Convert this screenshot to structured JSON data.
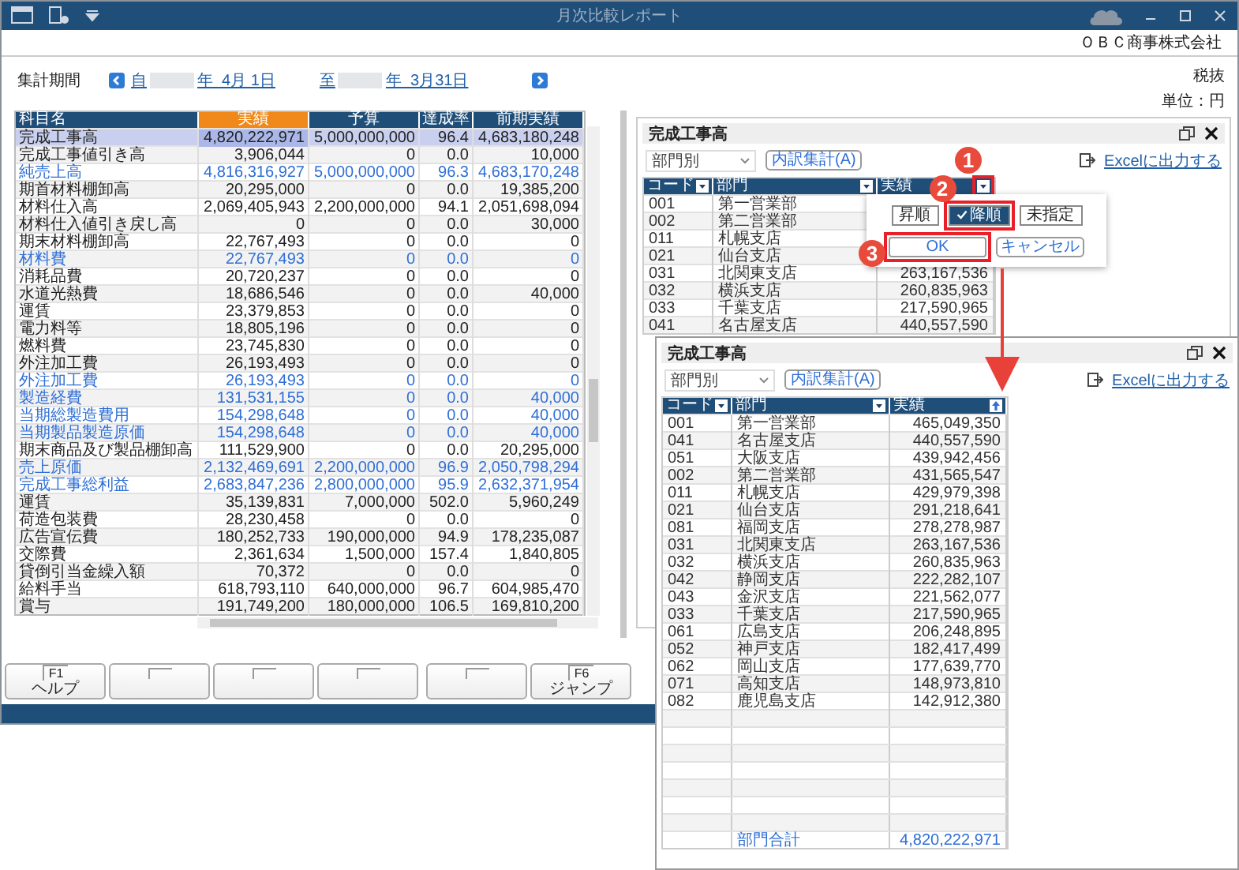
{
  "window": {
    "title": "月次比較レポート",
    "company": "ＯＢＣ商事株式会社"
  },
  "period": {
    "label": "集計期間",
    "from_prefix": "自",
    "from_date": "年  4月 1日",
    "to_prefix": "至",
    "to_date": "年  3月31日"
  },
  "tax": "税抜",
  "unit": "単位：円",
  "report_table": {
    "columns": [
      {
        "label": "科目名",
        "selected": false
      },
      {
        "label": "実績",
        "selected": true
      },
      {
        "label": "予算",
        "selected": false
      },
      {
        "label": "達成率",
        "selected": false
      },
      {
        "label": "前期実績",
        "selected": false
      }
    ],
    "rows": [
      {
        "cells": [
          "完成工事高",
          "4,820,222,971",
          "5,000,000,000",
          "96.4",
          "4,683,180,248"
        ],
        "kind": "normal",
        "selected": true
      },
      {
        "cells": [
          "完成工事値引き高",
          "3,906,044",
          "0",
          "0.0",
          "10,000"
        ],
        "kind": "normal",
        "selected": false
      },
      {
        "cells": [
          "純売上高",
          "4,816,316,927",
          "5,000,000,000",
          "96.3",
          "4,683,170,248"
        ],
        "kind": "subtotal",
        "selected": false
      },
      {
        "cells": [
          "期首材料棚卸高",
          "20,295,000",
          "0",
          "0.0",
          "19,385,200"
        ],
        "kind": "normal",
        "selected": false
      },
      {
        "cells": [
          "材料仕入高",
          "2,069,405,943",
          "2,200,000,000",
          "94.1",
          "2,051,698,094"
        ],
        "kind": "normal",
        "selected": false
      },
      {
        "cells": [
          "材料仕入値引き戻し高",
          "0",
          "0",
          "0.0",
          "30,000"
        ],
        "kind": "normal",
        "selected": false
      },
      {
        "cells": [
          "期末材料棚卸高",
          "22,767,493",
          "0",
          "0.0",
          "0"
        ],
        "kind": "normal",
        "selected": false
      },
      {
        "cells": [
          "材料費",
          "22,767,493",
          "0",
          "0.0",
          "0"
        ],
        "kind": "subtotal",
        "selected": false
      },
      {
        "cells": [
          "消耗品費",
          "20,720,237",
          "0",
          "0.0",
          "0"
        ],
        "kind": "normal",
        "selected": false
      },
      {
        "cells": [
          "水道光熱費",
          "18,686,546",
          "0",
          "0.0",
          "40,000"
        ],
        "kind": "normal",
        "selected": false
      },
      {
        "cells": [
          "運賃",
          "23,379,853",
          "0",
          "0.0",
          "0"
        ],
        "kind": "normal",
        "selected": false
      },
      {
        "cells": [
          "電力料等",
          "18,805,196",
          "0",
          "0.0",
          "0"
        ],
        "kind": "normal",
        "selected": false
      },
      {
        "cells": [
          "燃料費",
          "23,745,830",
          "0",
          "0.0",
          "0"
        ],
        "kind": "normal",
        "selected": false
      },
      {
        "cells": [
          "外注加工費",
          "26,193,493",
          "0",
          "0.0",
          "0"
        ],
        "kind": "normal",
        "selected": false
      },
      {
        "cells": [
          "外注加工費",
          "26,193,493",
          "0",
          "0.0",
          "0"
        ],
        "kind": "subtotal",
        "selected": false
      },
      {
        "cells": [
          "製造経費",
          "131,531,155",
          "0",
          "0.0",
          "40,000"
        ],
        "kind": "subtotal",
        "selected": false
      },
      {
        "cells": [
          "当期総製造費用",
          "154,298,648",
          "0",
          "0.0",
          "40,000"
        ],
        "kind": "subtotal",
        "selected": false
      },
      {
        "cells": [
          "当期製品製造原価",
          "154,298,648",
          "0",
          "0.0",
          "40,000"
        ],
        "kind": "subtotal",
        "selected": false
      },
      {
        "cells": [
          "期末商品及び製品棚卸高",
          "111,529,900",
          "0",
          "0.0",
          "20,295,000"
        ],
        "kind": "normal",
        "selected": false
      },
      {
        "cells": [
          "売上原価",
          "2,132,469,691",
          "2,200,000,000",
          "96.9",
          "2,050,798,294"
        ],
        "kind": "subtotal",
        "selected": false
      },
      {
        "cells": [
          "完成工事総利益",
          "2,683,847,236",
          "2,800,000,000",
          "95.9",
          "2,632,371,954"
        ],
        "kind": "subtotal",
        "selected": false
      },
      {
        "cells": [
          "運賃",
          "35,139,831",
          "7,000,000",
          "502.0",
          "5,960,249"
        ],
        "kind": "normal",
        "selected": false
      },
      {
        "cells": [
          "荷造包装費",
          "28,230,458",
          "0",
          "0.0",
          "0"
        ],
        "kind": "normal",
        "selected": false
      },
      {
        "cells": [
          "広告宣伝費",
          "180,252,733",
          "190,000,000",
          "94.9",
          "178,235,087"
        ],
        "kind": "normal",
        "selected": false
      },
      {
        "cells": [
          "交際費",
          "2,361,634",
          "1,500,000",
          "157.4",
          "1,840,805"
        ],
        "kind": "normal",
        "selected": false
      },
      {
        "cells": [
          "貸倒引当金繰入額",
          "70,372",
          "0",
          "0.0",
          "0"
        ],
        "kind": "normal",
        "selected": false
      },
      {
        "cells": [
          "給料手当",
          "618,793,110",
          "640,000,000",
          "96.7",
          "604,985,470"
        ],
        "kind": "normal",
        "selected": false
      },
      {
        "cells": [
          "賞与",
          "191,749,200",
          "180,000,000",
          "106.5",
          "169,810,200"
        ],
        "kind": "normal",
        "selected": false
      }
    ]
  },
  "function_keys": [
    {
      "kind": "assigned",
      "key": "F1",
      "label": "ヘルプ"
    },
    {
      "kind": "blank"
    },
    {
      "kind": "blank"
    },
    {
      "kind": "blank"
    },
    {
      "kind": "blank"
    },
    {
      "kind": "assigned",
      "key": "F6",
      "label": "ジャンプ"
    }
  ],
  "detail_panel": {
    "title": "完成工事高",
    "filter": "部門別",
    "breakdown_button": "内訳集計(A)",
    "export_link": "Excelに出力する",
    "columns": [
      {
        "label": "コード",
        "kind": "filter"
      },
      {
        "label": "部門",
        "kind": "filter"
      },
      {
        "label": "実績",
        "kind": "filter",
        "callout": "1"
      }
    ],
    "rows": [
      {
        "code": "001",
        "name": "第一営業部"
      },
      {
        "code": "002",
        "name": "第二営業部"
      },
      {
        "code": "011",
        "name": "札幌支店"
      },
      {
        "code": "021",
        "name": "仙台支店"
      },
      {
        "code": "031",
        "name": "北関東支店",
        "amount": "263,167,536"
      },
      {
        "code": "032",
        "name": "横浜支店",
        "amount": "260,835,963"
      },
      {
        "code": "033",
        "name": "千葉支店",
        "amount": "217,590,965"
      },
      {
        "code": "041",
        "name": "名古屋支店",
        "amount": "440,557,590"
      }
    ]
  },
  "sort_menu": {
    "options": [
      {
        "label": "昇順",
        "selected": false
      },
      {
        "label": "降順",
        "selected": true,
        "callout": "2"
      },
      {
        "label": "未指定",
        "selected": false
      }
    ],
    "ok": "OK",
    "ok_callout": "3",
    "cancel": "キャンセル"
  },
  "sorted_panel": {
    "title": "完成工事高",
    "filter": "部門別",
    "breakdown_button": "内訳集計(A)",
    "export_link": "Excelに出力する",
    "columns": [
      {
        "label": "コード",
        "kind": "filter"
      },
      {
        "label": "部門",
        "kind": "filter"
      },
      {
        "label": "実績",
        "kind": "sort"
      }
    ],
    "rows": [
      {
        "code": "001",
        "name": "第一営業部",
        "amount": "465,049,350"
      },
      {
        "code": "041",
        "name": "名古屋支店",
        "amount": "440,557,590"
      },
      {
        "code": "051",
        "name": "大阪支店",
        "amount": "439,942,456"
      },
      {
        "code": "002",
        "name": "第二営業部",
        "amount": "431,565,547"
      },
      {
        "code": "011",
        "name": "札幌支店",
        "amount": "429,979,398"
      },
      {
        "code": "021",
        "name": "仙台支店",
        "amount": "291,218,641"
      },
      {
        "code": "081",
        "name": "福岡支店",
        "amount": "278,278,987"
      },
      {
        "code": "031",
        "name": "北関東支店",
        "amount": "263,167,536"
      },
      {
        "code": "032",
        "name": "横浜支店",
        "amount": "260,835,963"
      },
      {
        "code": "042",
        "name": "静岡支店",
        "amount": "222,282,107"
      },
      {
        "code": "043",
        "name": "金沢支店",
        "amount": "221,562,077"
      },
      {
        "code": "033",
        "name": "千葉支店",
        "amount": "217,590,965"
      },
      {
        "code": "061",
        "name": "広島支店",
        "amount": "206,248,895"
      },
      {
        "code": "052",
        "name": "神戸支店",
        "amount": "182,417,499"
      },
      {
        "code": "062",
        "name": "岡山支店",
        "amount": "177,639,770"
      },
      {
        "code": "071",
        "name": "高知支店",
        "amount": "148,973,810"
      },
      {
        "code": "082",
        "name": "鹿児島支店",
        "amount": "142,912,380"
      }
    ],
    "total": {
      "label": "部門合計",
      "amount": "4,820,222,971"
    }
  }
}
